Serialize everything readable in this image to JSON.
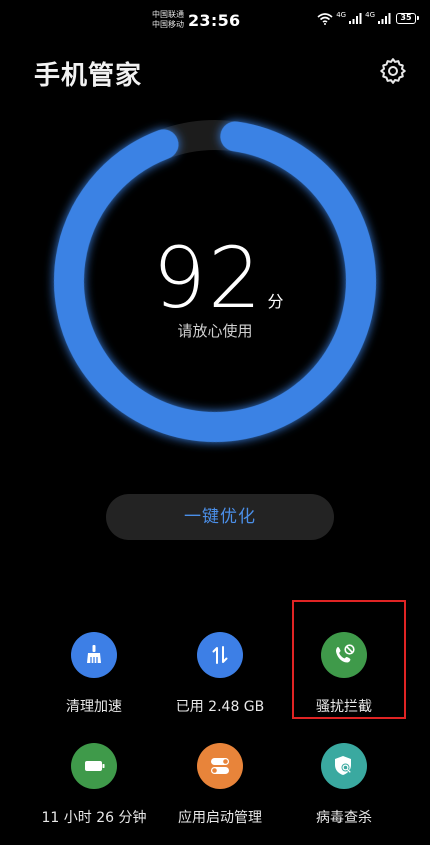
{
  "status_bar": {
    "carrier_1": "中国联通",
    "carrier_2": "中国移动",
    "time": "23:56",
    "net_1": "4G",
    "net_2": "4G",
    "battery": "35"
  },
  "header": {
    "title": "手机管家",
    "settings_icon": "gear-icon"
  },
  "score": {
    "value": "92",
    "unit": "分",
    "status": "请放心使用",
    "ring_fill_fraction": 0.92,
    "ring_color": "#3a82e4",
    "track_color": "#1c1c1c"
  },
  "optimize_button": {
    "label": "一键优化",
    "color": "#4b8fe8"
  },
  "tools": [
    {
      "label": "清理加速",
      "icon": "broom-icon",
      "color": "#3d7fe6"
    },
    {
      "label": "已用 2.48 GB",
      "icon": "data-transfer-icon",
      "color": "#3d7fe6"
    },
    {
      "label": "骚扰拦截",
      "icon": "blocked-call-icon",
      "color": "#3f9a4a"
    },
    {
      "label": "11 小时 26 分钟",
      "icon": "battery-icon",
      "color": "#3f9a4a"
    },
    {
      "label": "应用启动管理",
      "icon": "toggle-switches-icon",
      "color": "#e8843a"
    },
    {
      "label": "病毒查杀",
      "icon": "shield-scan-icon",
      "color": "#3aa9a0"
    }
  ],
  "highlight": {
    "target": "骚扰拦截",
    "color": "#e02424"
  }
}
